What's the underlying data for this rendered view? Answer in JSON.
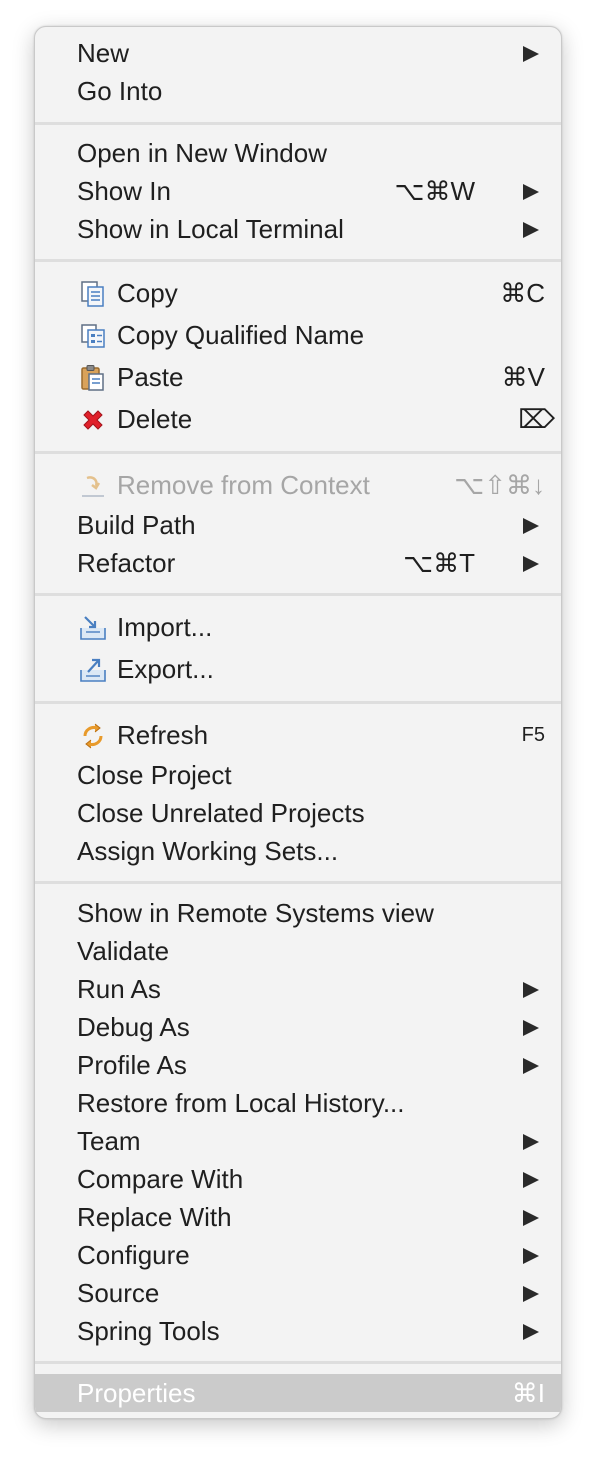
{
  "menu": {
    "new": {
      "label": "New"
    },
    "go_into": {
      "label": "Go Into"
    },
    "open_new_window": {
      "label": "Open in New Window"
    },
    "show_in": {
      "label": "Show In",
      "shortcut": "⌥⌘W"
    },
    "show_local_terminal": {
      "label": "Show in Local Terminal"
    },
    "copy": {
      "label": "Copy",
      "shortcut": "⌘C",
      "icon": "copy-icon"
    },
    "copy_qualified": {
      "label": "Copy Qualified Name",
      "icon": "copy-qualified-name-icon"
    },
    "paste": {
      "label": "Paste",
      "shortcut": "⌘V",
      "icon": "paste-icon"
    },
    "delete": {
      "label": "Delete",
      "shortcut": "⌦",
      "icon": "delete-icon"
    },
    "remove_context": {
      "label": "Remove from Context",
      "shortcut": "⌥⇧⌘↓",
      "icon": "remove-context-icon"
    },
    "build_path": {
      "label": "Build Path"
    },
    "refactor": {
      "label": "Refactor",
      "shortcut": "⌥⌘T"
    },
    "import": {
      "label": "Import...",
      "icon": "import-icon"
    },
    "export": {
      "label": "Export...",
      "icon": "export-icon"
    },
    "refresh": {
      "label": "Refresh",
      "shortcut": "F5",
      "icon": "refresh-icon"
    },
    "close_project": {
      "label": "Close Project"
    },
    "close_unrelated": {
      "label": "Close Unrelated Projects"
    },
    "assign_working_sets": {
      "label": "Assign Working Sets..."
    },
    "show_remote": {
      "label": "Show in Remote Systems view"
    },
    "validate": {
      "label": "Validate"
    },
    "run_as": {
      "label": "Run As"
    },
    "debug_as": {
      "label": "Debug As"
    },
    "profile_as": {
      "label": "Profile As"
    },
    "restore_history": {
      "label": "Restore from Local History..."
    },
    "team": {
      "label": "Team"
    },
    "compare_with": {
      "label": "Compare With"
    },
    "replace_with": {
      "label": "Replace With"
    },
    "configure": {
      "label": "Configure"
    },
    "source": {
      "label": "Source"
    },
    "spring_tools": {
      "label": "Spring Tools"
    },
    "properties": {
      "label": "Properties",
      "shortcut": "⌘I"
    }
  },
  "colors": {
    "menu_background": "#f3f3f3",
    "highlight": "#cbcbcb",
    "disabled_text": "#a6a6a6",
    "delete_red": "#e0202a",
    "refresh_orange": "#e89a2b",
    "icon_blue": "#4a7fc1"
  }
}
